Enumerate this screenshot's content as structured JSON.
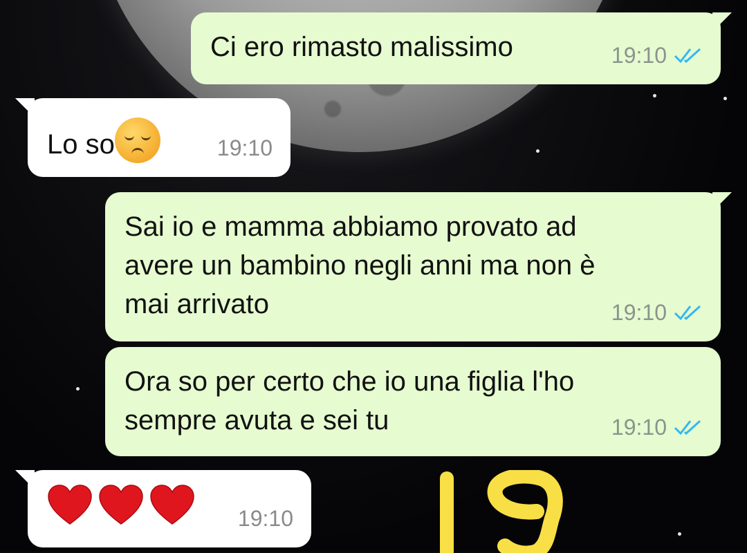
{
  "messages": [
    {
      "id": "m1",
      "direction": "out",
      "text": "Ci ero rimasto malissimo",
      "time": "19:10",
      "status": "read"
    },
    {
      "id": "m2",
      "direction": "in",
      "text": "Lo so",
      "emoji": "pensive-face",
      "time": "19:10"
    },
    {
      "id": "m3",
      "direction": "out",
      "lines": [
        "Sai io e mamma abbiamo provato ad",
        "avere un bambino negli anni ma non è",
        "mai arrivato"
      ],
      "time": "19:10",
      "status": "read"
    },
    {
      "id": "m4",
      "direction": "out",
      "lines": [
        "Ora so per certo che io una figlia l'ho",
        "sempre avuta e sei tu"
      ],
      "time": "19:10",
      "status": "read"
    },
    {
      "id": "m5",
      "direction": "in",
      "emoji": "three-red-hearts",
      "time": "19:10"
    }
  ],
  "overlay": {
    "number": "19",
    "color": "#f7df45"
  },
  "colors": {
    "outgoing": "#e6fbd0",
    "incoming": "#ffffff",
    "tick": "#34b7f1",
    "heart": "#e0161f"
  }
}
